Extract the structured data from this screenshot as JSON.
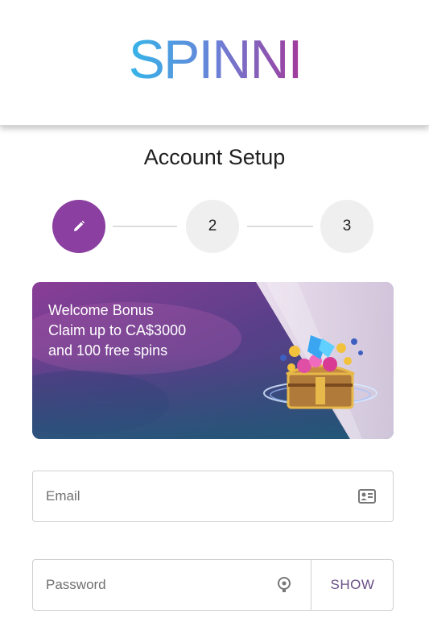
{
  "brand": {
    "name": "SPINNI",
    "gradient": [
      "#35b5e8",
      "#6a82d8",
      "#a23a9a"
    ]
  },
  "page": {
    "title": "Account Setup"
  },
  "stepper": {
    "active_color": "#8b3fa0",
    "steps": [
      {
        "label": "",
        "icon": "pencil-icon",
        "state": "active"
      },
      {
        "label": "2",
        "state": "pending"
      },
      {
        "label": "3",
        "state": "pending"
      }
    ]
  },
  "banner": {
    "line1": "Welcome Bonus",
    "line2": "Claim up to CA$3000",
    "line3": "and 100 free spins",
    "image": "treasure-chest-illustration"
  },
  "form": {
    "email": {
      "placeholder": "Email",
      "value": "",
      "icon": "contact-card-icon"
    },
    "password": {
      "placeholder": "Password",
      "value": "",
      "icon": "key-icon",
      "show_label": "SHOW"
    }
  }
}
